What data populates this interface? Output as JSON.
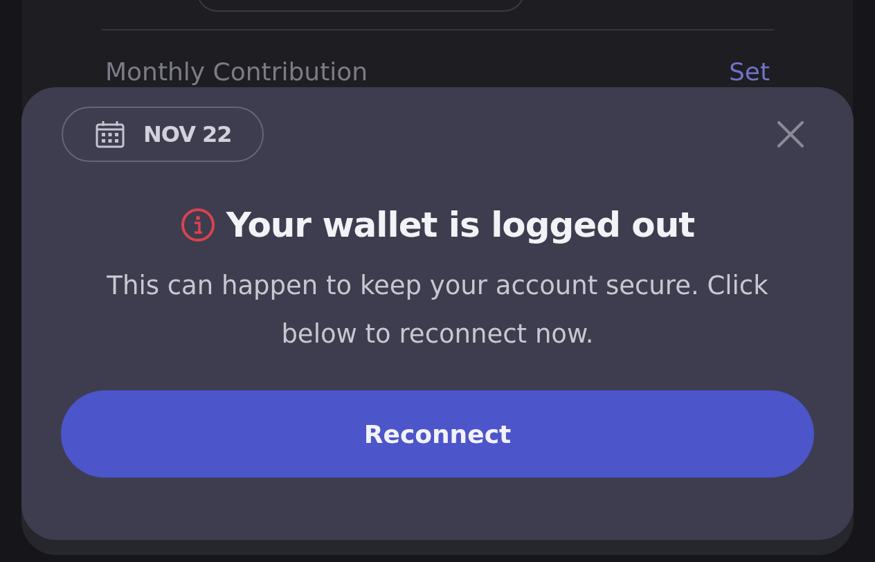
{
  "background": {
    "label": "Monthly Contribution",
    "action": "Set"
  },
  "sheet": {
    "date": "NOV 22",
    "title": "Your wallet is logged out",
    "body": "This can happen to keep your account secure. Click below to reconnect now.",
    "button": "Reconnect"
  }
}
